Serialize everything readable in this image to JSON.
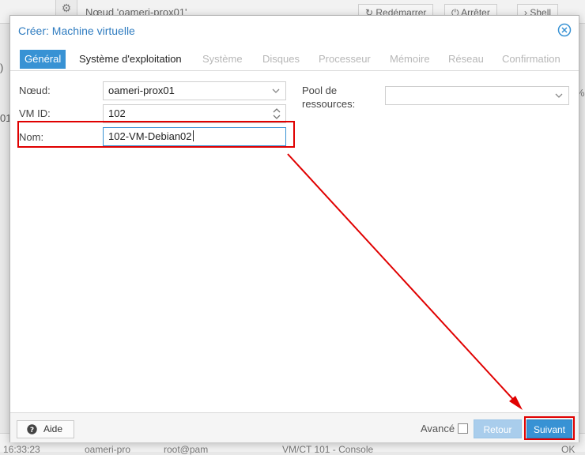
{
  "background": {
    "node_label": "Nœud 'oameri-prox01'",
    "restart_label": "Redémarrer",
    "stop_label": "Arrêter",
    "shell_label": "Shell",
    "left_fragment_1": ")",
    "left_fragment_2": "01",
    "right_fragment": "%",
    "log": {
      "time": "16:33:23",
      "node": "oameri-pro",
      "user": "root@pam",
      "desc": "VM/CT 101 - Console",
      "status": "OK"
    }
  },
  "dialog": {
    "title": "Créer: Machine virtuelle",
    "tabs": [
      {
        "label": "Général",
        "state": "active"
      },
      {
        "label": "Système d'exploitation",
        "state": "enabled"
      },
      {
        "label": "Système",
        "state": "disabled"
      },
      {
        "label": "Disques",
        "state": "disabled"
      },
      {
        "label": "Processeur",
        "state": "disabled"
      },
      {
        "label": "Mémoire",
        "state": "disabled"
      },
      {
        "label": "Réseau",
        "state": "disabled"
      },
      {
        "label": "Confirmation",
        "state": "disabled"
      }
    ],
    "form": {
      "node_label": "Nœud:",
      "node_value": "oameri-prox01",
      "vmid_label": "VM ID:",
      "vmid_value": "102",
      "name_label": "Nom:",
      "name_value": "102-VM-Debian02",
      "pool_label_line1": "Pool de",
      "pool_label_line2": "ressources:",
      "pool_value": ""
    },
    "footer": {
      "help_label": "Aide",
      "advanced_label": "Avancé",
      "advanced_checked": false,
      "back_label": "Retour",
      "next_label": "Suivant"
    }
  },
  "colors": {
    "accent": "#3892d4",
    "annotation": "#e00000"
  }
}
